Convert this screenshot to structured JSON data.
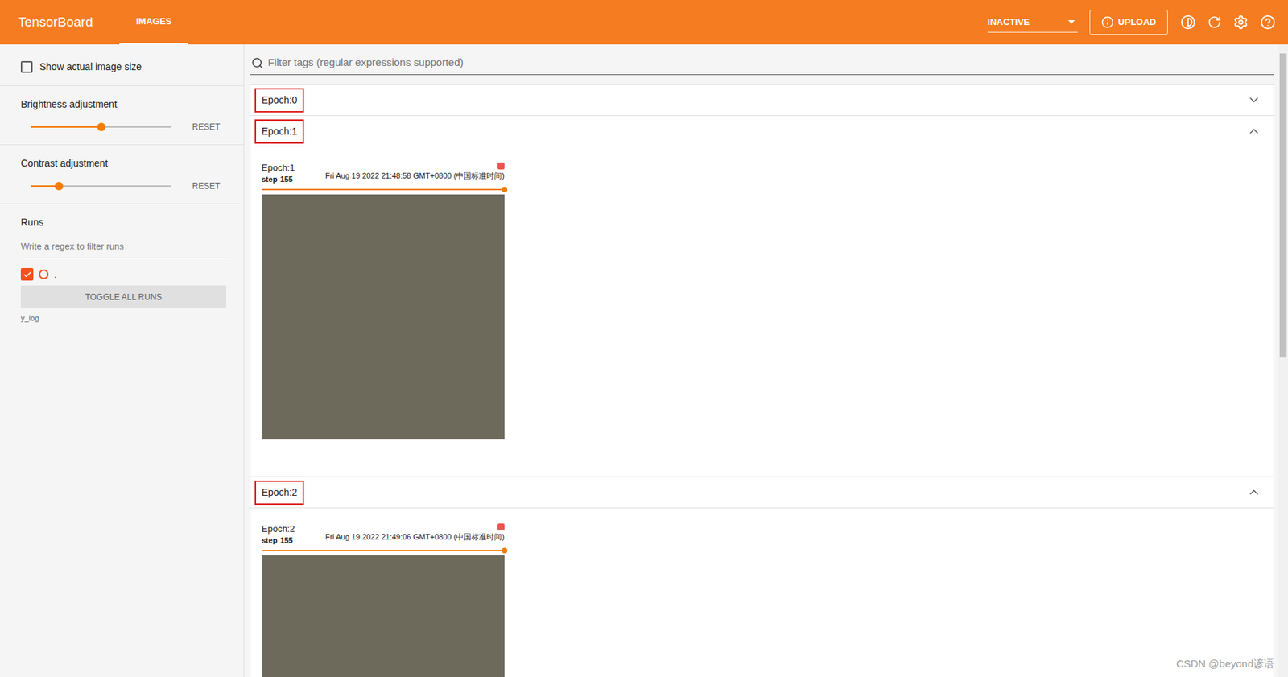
{
  "header": {
    "title": "TensorBoard",
    "tabs": [
      {
        "label": "IMAGES",
        "selected": true
      }
    ],
    "run_status": "INACTIVE",
    "upload_button": "UPLOAD"
  },
  "sidebar": {
    "show_actual_size": {
      "label": "Show actual image size",
      "checked": false
    },
    "sliders": [
      {
        "label": "Brightness adjustment",
        "level": 0.5,
        "reset": "RESET"
      },
      {
        "label": "Contrast adjustment",
        "level": 0.2,
        "reset": "RESET"
      }
    ],
    "runs": {
      "title": "Runs",
      "filter_placeholder": "Write a regex to filter runs",
      "items": [
        {
          "label": ".",
          "checked": true,
          "color": "#f4511e"
        }
      ],
      "toggle_button": "TOGGLE ALL RUNS",
      "log_dir": "y_log"
    }
  },
  "search": {
    "placeholder": "Filter tags (regular expressions supported)"
  },
  "groups": [
    {
      "label": "Epoch:0",
      "expanded": false,
      "annotated": true,
      "cards": []
    },
    {
      "label": "Epoch:1",
      "expanded": true,
      "annotated": true,
      "cards": [
        {
          "title": "Epoch:1",
          "step_label": "step",
          "step": "155",
          "time": "Fri Aug 19 2022 21:48:58 GMT+0800 (中国标准时间)",
          "level": 1
        }
      ]
    },
    {
      "label": "Epoch:2",
      "expanded": true,
      "annotated": true,
      "cards": [
        {
          "title": "Epoch:2",
          "step_label": "step",
          "step": "155",
          "time": "Fri Aug 19 2022 21:49:06 GMT+0800 (中国标准时间)",
          "level": 1
        }
      ]
    }
  ],
  "watermark": "CSDN @beyond谚语"
}
